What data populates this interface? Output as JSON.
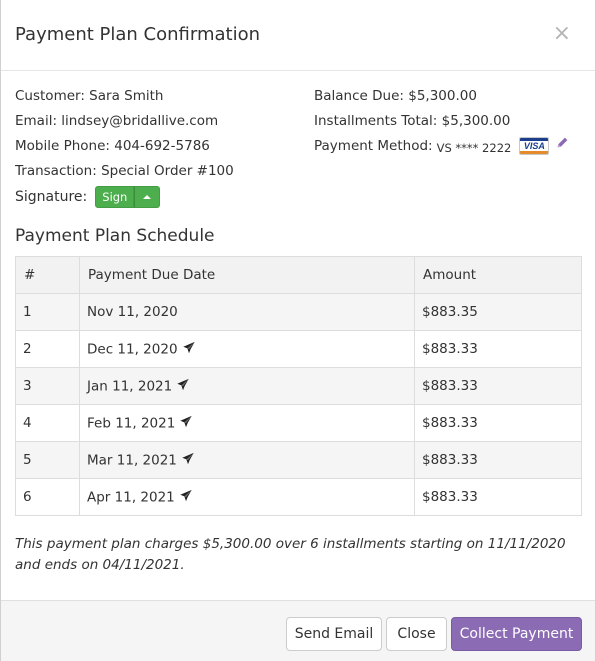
{
  "header": {
    "title": "Payment Plan Confirmation",
    "close_glyph": "×"
  },
  "customer": {
    "customer": "Customer: Sara Smith",
    "email": "Email: lindsey@bridallive.com",
    "phone": "Mobile Phone: 404-692-5786",
    "transaction": "Transaction: Special Order #100",
    "signature_label": "Signature:",
    "sign_button": "Sign"
  },
  "balance": {
    "balance_due": "Balance Due: $5,300.00",
    "installments_total": "Installments Total: $5,300.00",
    "payment_method_label": "Payment Method:",
    "card_number": "VS **** 2222",
    "card_brand": "VISA"
  },
  "schedule": {
    "title": "Payment Plan Schedule",
    "columns": [
      "#",
      "Payment Due Date",
      "Amount"
    ],
    "rows": [
      {
        "num": "1",
        "date": "Nov 11, 2020",
        "amount": "$883.35",
        "sent": false
      },
      {
        "num": "2",
        "date": "Dec 11, 2020",
        "amount": "$883.33",
        "sent": true
      },
      {
        "num": "3",
        "date": "Jan 11, 2021",
        "amount": "$883.33",
        "sent": true
      },
      {
        "num": "4",
        "date": "Feb 11, 2021",
        "amount": "$883.33",
        "sent": true
      },
      {
        "num": "5",
        "date": "Mar 11, 2021",
        "amount": "$883.33",
        "sent": true
      },
      {
        "num": "6",
        "date": "Apr 11, 2021",
        "amount": "$883.33",
        "sent": true
      }
    ]
  },
  "summary": "This payment plan charges $5,300.00 over 6 installments starting on 11/11/2020 and ends on 04/11/2021.",
  "footer": {
    "send_email": "Send Email",
    "close": "Close",
    "collect_payment": "Collect Payment"
  },
  "colors": {
    "accent": "#8b6bb3",
    "sign_green": "#4cae4c"
  },
  "icons": {
    "close": "close-icon",
    "edit": "pencil-icon",
    "card": "visa-card-icon",
    "sent": "paper-plane-icon",
    "caret": "caret-up-icon"
  }
}
